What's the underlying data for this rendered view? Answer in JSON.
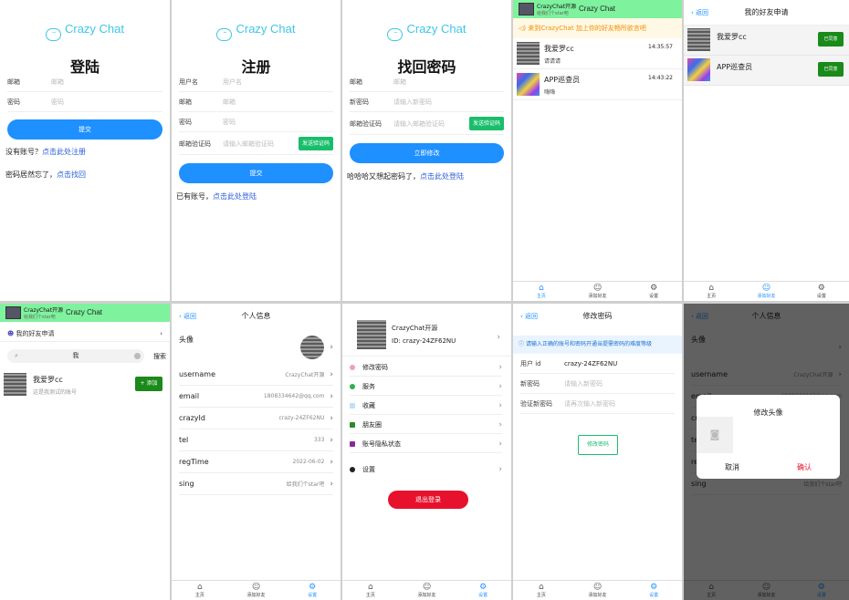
{
  "logo_text": "Crazy Chat",
  "login": {
    "title": "登陆",
    "email_label": "邮箱",
    "email_ph": "邮箱",
    "pwd_label": "密码",
    "pwd_ph": "密码",
    "submit": "提交",
    "no_account": "没有账号？",
    "register_link": "点击此处注册",
    "forgot": "密码居然忘了，",
    "forgot_link": "点击找回"
  },
  "register": {
    "title": "注册",
    "user_label": "用户名",
    "user_ph": "用户名",
    "email_label": "邮箱",
    "email_ph": "邮箱",
    "pwd_label": "密码",
    "pwd_ph": "密码",
    "code_label": "邮箱验证码",
    "code_ph": "请输入邮箱验证码",
    "send_code": "发送验证码",
    "submit": "提交",
    "has_account": "已有账号，",
    "login_link": "点击此处登陆"
  },
  "recover": {
    "title": "找回密码",
    "email_label": "邮箱",
    "email_ph": "邮箱",
    "new_label": "新密码",
    "new_ph": "请输入新密码",
    "code_label": "邮箱验证码",
    "code_ph": "请输入邮箱验证码",
    "send_code": "发送验证码",
    "submit": "立即修改",
    "remember": "哈哈哈又想起密码了，",
    "login_link": "点击此处登陆"
  },
  "header": {
    "name": "CrazyChat开源",
    "sub": "给我们个star吧",
    "title": "Crazy Chat"
  },
  "home": {
    "notice": "来到CrazyChat 加上你的好友畅所欲言吧",
    "chats": [
      {
        "name": "我爱罗cc",
        "msg": "请请请",
        "time": "14:35:57"
      },
      {
        "name": "APP巡查员",
        "msg": "嗨嗨",
        "time": "14:43:22"
      }
    ]
  },
  "tabs": {
    "home": "主页",
    "friends": "添加好友",
    "settings": "设置"
  },
  "requests": {
    "back": "返回",
    "title": "我的好友申请",
    "items": [
      {
        "name": "我爱罗cc",
        "status": "已同意"
      },
      {
        "name": "APP巡查员",
        "status": "已同意"
      }
    ]
  },
  "add_friend": {
    "my_requests": "我的好友申请",
    "search_value": "我",
    "search_btn": "搜索",
    "result_name": "我爱罗cc",
    "result_desc": "这是我测试的账号",
    "add_btn": "添加"
  },
  "profile": {
    "back": "返回",
    "title": "个人信息",
    "avatar_label": "头像",
    "rows": [
      {
        "label": "username",
        "value": "CrazyChat开源"
      },
      {
        "label": "email",
        "value": "1808334642@qq.com"
      },
      {
        "label": "crazyId",
        "value": "crazy-24ZF62NU"
      },
      {
        "label": "tel",
        "value": "333"
      },
      {
        "label": "regTime",
        "value": "2022-06-02"
      },
      {
        "label": "sing",
        "value": "给我们个star吧"
      }
    ]
  },
  "settings": {
    "name": "CrazyChat开源",
    "id": "ID: crazy-24ZF62NU",
    "menu": [
      "修改密码",
      "服务",
      "收藏",
      "朋友圈",
      "账号隐私状态",
      "设置"
    ],
    "logout": "退出登录"
  },
  "change_pwd": {
    "back": "返回",
    "title": "修改密码",
    "notice": "请输入正确的账号和密码开通当提需密码的难度等级",
    "user_label": "用户 id",
    "user_value": "crazy-24ZF62NU",
    "new_label": "新密码",
    "new_ph": "请输入新密码",
    "confirm_label": "验证新密码",
    "confirm_ph": "请再次输入新密码",
    "submit": "修改密码"
  },
  "dialog": {
    "title": "修改头像",
    "cancel": "取消",
    "confirm": "确认"
  },
  "colors": {
    "primary": "#1e90ff",
    "green": "#19be6b",
    "header": "#7ef29d",
    "logout": "#e8112d"
  }
}
